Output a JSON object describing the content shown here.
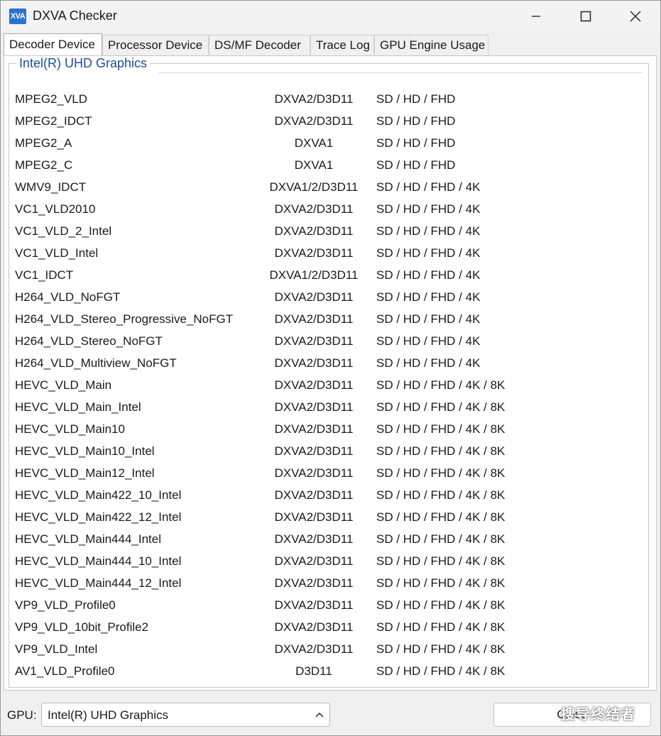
{
  "window": {
    "title": "DXVA Checker",
    "icon_text": "XVA",
    "icons": [
      "app-icon",
      "minimize-icon",
      "maximize-icon",
      "close-icon"
    ]
  },
  "tabs": [
    {
      "label": "Decoder Device",
      "active": true
    },
    {
      "label": "Processor Device",
      "active": false
    },
    {
      "label": "DS/MF Decoder",
      "active": false
    },
    {
      "label": "Trace Log",
      "active": false
    },
    {
      "label": "GPU Engine Usage",
      "active": false
    }
  ],
  "group": {
    "title": "Intel(R) UHD Graphics"
  },
  "decoders": [
    {
      "name": "MPEG2_VLD",
      "api": "DXVA2/D3D11",
      "res": "SD / HD / FHD"
    },
    {
      "name": "MPEG2_IDCT",
      "api": "DXVA2/D3D11",
      "res": "SD / HD / FHD"
    },
    {
      "name": "MPEG2_A",
      "api": "DXVA1",
      "res": "SD / HD / FHD"
    },
    {
      "name": "MPEG2_C",
      "api": "DXVA1",
      "res": "SD / HD / FHD"
    },
    {
      "name": "WMV9_IDCT",
      "api": "DXVA1/2/D3D11",
      "res": "SD / HD / FHD / 4K"
    },
    {
      "name": "VC1_VLD2010",
      "api": "DXVA2/D3D11",
      "res": "SD / HD / FHD / 4K"
    },
    {
      "name": "VC1_VLD_2_Intel",
      "api": "DXVA2/D3D11",
      "res": "SD / HD / FHD / 4K"
    },
    {
      "name": "VC1_VLD_Intel",
      "api": "DXVA2/D3D11",
      "res": "SD / HD / FHD / 4K"
    },
    {
      "name": "VC1_IDCT",
      "api": "DXVA1/2/D3D11",
      "res": "SD / HD / FHD / 4K"
    },
    {
      "name": "H264_VLD_NoFGT",
      "api": "DXVA2/D3D11",
      "res": "SD / HD / FHD / 4K"
    },
    {
      "name": "H264_VLD_Stereo_Progressive_NoFGT",
      "api": "DXVA2/D3D11",
      "res": "SD / HD / FHD / 4K"
    },
    {
      "name": "H264_VLD_Stereo_NoFGT",
      "api": "DXVA2/D3D11",
      "res": "SD / HD / FHD / 4K"
    },
    {
      "name": "H264_VLD_Multiview_NoFGT",
      "api": "DXVA2/D3D11",
      "res": "SD / HD / FHD / 4K"
    },
    {
      "name": "HEVC_VLD_Main",
      "api": "DXVA2/D3D11",
      "res": "SD / HD / FHD / 4K / 8K"
    },
    {
      "name": "HEVC_VLD_Main_Intel",
      "api": "DXVA2/D3D11",
      "res": "SD / HD / FHD / 4K / 8K"
    },
    {
      "name": "HEVC_VLD_Main10",
      "api": "DXVA2/D3D11",
      "res": "SD / HD / FHD / 4K / 8K"
    },
    {
      "name": "HEVC_VLD_Main10_Intel",
      "api": "DXVA2/D3D11",
      "res": "SD / HD / FHD / 4K / 8K"
    },
    {
      "name": "HEVC_VLD_Main12_Intel",
      "api": "DXVA2/D3D11",
      "res": "SD / HD / FHD / 4K / 8K"
    },
    {
      "name": "HEVC_VLD_Main422_10_Intel",
      "api": "DXVA2/D3D11",
      "res": "SD / HD / FHD / 4K / 8K"
    },
    {
      "name": "HEVC_VLD_Main422_12_Intel",
      "api": "DXVA2/D3D11",
      "res": "SD / HD / FHD / 4K / 8K"
    },
    {
      "name": "HEVC_VLD_Main444_Intel",
      "api": "DXVA2/D3D11",
      "res": "SD / HD / FHD / 4K / 8K"
    },
    {
      "name": "HEVC_VLD_Main444_10_Intel",
      "api": "DXVA2/D3D11",
      "res": "SD / HD / FHD / 4K / 8K"
    },
    {
      "name": "HEVC_VLD_Main444_12_Intel",
      "api": "DXVA2/D3D11",
      "res": "SD / HD / FHD / 4K / 8K"
    },
    {
      "name": "VP9_VLD_Profile0",
      "api": "DXVA2/D3D11",
      "res": "SD / HD / FHD / 4K / 8K"
    },
    {
      "name": "VP9_VLD_10bit_Profile2",
      "api": "DXVA2/D3D11",
      "res": "SD / HD / FHD / 4K / 8K"
    },
    {
      "name": "VP9_VLD_Intel",
      "api": "DXVA2/D3D11",
      "res": "SD / HD / FHD / 4K / 8K"
    },
    {
      "name": "AV1_VLD_Profile0",
      "api": "D3D11",
      "res": "SD / HD / FHD / 4K / 8K"
    }
  ],
  "footer": {
    "gpu_label": "GPU:",
    "gpu_selected": "Intel(R) UHD Graphics",
    "close_label": "Close",
    "watermark": "搜导终结者"
  },
  "colors": {
    "accent": "#1e4e9a",
    "app_icon": "#2b73c9"
  }
}
